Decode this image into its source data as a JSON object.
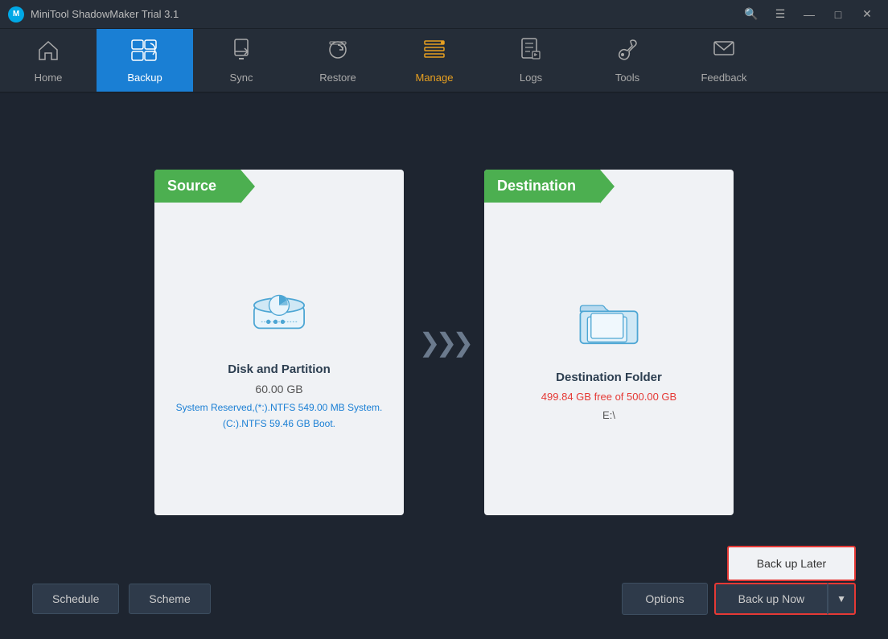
{
  "titleBar": {
    "title": "MiniTool ShadowMaker Trial 3.1",
    "logo": "M",
    "controls": {
      "search": "🔍",
      "menu": "≡",
      "minimize": "—",
      "maximize": "□",
      "close": "✕"
    }
  },
  "nav": {
    "items": [
      {
        "id": "home",
        "label": "Home",
        "icon": "🏠",
        "active": false
      },
      {
        "id": "backup",
        "label": "Backup",
        "icon": "⊞",
        "active": true
      },
      {
        "id": "sync",
        "label": "Sync",
        "icon": "🔄",
        "active": false
      },
      {
        "id": "restore",
        "label": "Restore",
        "icon": "⟳",
        "active": false
      },
      {
        "id": "manage",
        "label": "Manage",
        "icon": "⚙",
        "active": false
      },
      {
        "id": "logs",
        "label": "Logs",
        "icon": "📋",
        "active": false
      },
      {
        "id": "tools",
        "label": "Tools",
        "icon": "🔧",
        "active": false
      },
      {
        "id": "feedback",
        "label": "Feedback",
        "icon": "✉",
        "active": false
      }
    ]
  },
  "source": {
    "header": "Source",
    "title": "Disk and Partition",
    "size": "60.00 GB",
    "detail": "System Reserved,(*:).NTFS 549.00 MB System.\n(C:).NTFS 59.46 GB Boot."
  },
  "destination": {
    "header": "Destination",
    "title": "Destination Folder",
    "free": "499.84 GB free of 500.00 GB",
    "drive": "E:\\"
  },
  "buttons": {
    "schedule": "Schedule",
    "scheme": "Scheme",
    "options": "Options",
    "backupNow": "Back up Now",
    "backupLater": "Back up Later"
  }
}
